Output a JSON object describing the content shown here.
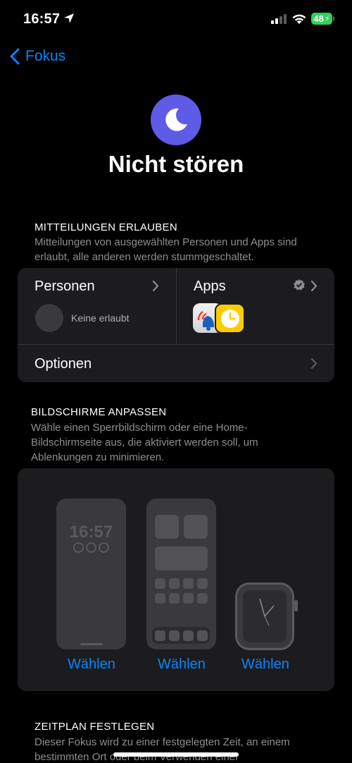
{
  "status_bar": {
    "time": "16:57",
    "battery": "48"
  },
  "nav": {
    "back_label": "Fokus"
  },
  "header": {
    "title": "Nicht stören"
  },
  "allowed": {
    "heading": "MITTEILUNGEN ERLAUBEN",
    "description": "Mitteilungen von ausgewählten Personen und Apps sind erlaubt, alle anderen werden stummgeschaltet.",
    "people_label": "Personen",
    "people_status": "Keine erlaubt",
    "apps_label": "Apps",
    "options_label": "Optionen"
  },
  "screens": {
    "heading": "BILDSCHIRME ANPASSEN",
    "description": "Wähle einen Sperrbildschirm oder eine Home-Bildschirmseite aus, die aktiviert werden soll, um Ablenkungen zu minimieren.",
    "lock_preview_time": "16:57",
    "choose_lock": "Wählen",
    "choose_home": "Wählen",
    "choose_watch": "Wählen"
  },
  "schedule": {
    "heading": "ZEITPLAN FESTLEGEN",
    "description": "Dieser Fokus wird zu einer festgelegten Zeit, an einem bestimmten Ort oder beim Verwenden einer"
  },
  "colors": {
    "accent": "#0a84ff",
    "focus_purple": "#5e5ce6",
    "card_bg": "#1c1c1e",
    "battery_green": "#30d158"
  }
}
